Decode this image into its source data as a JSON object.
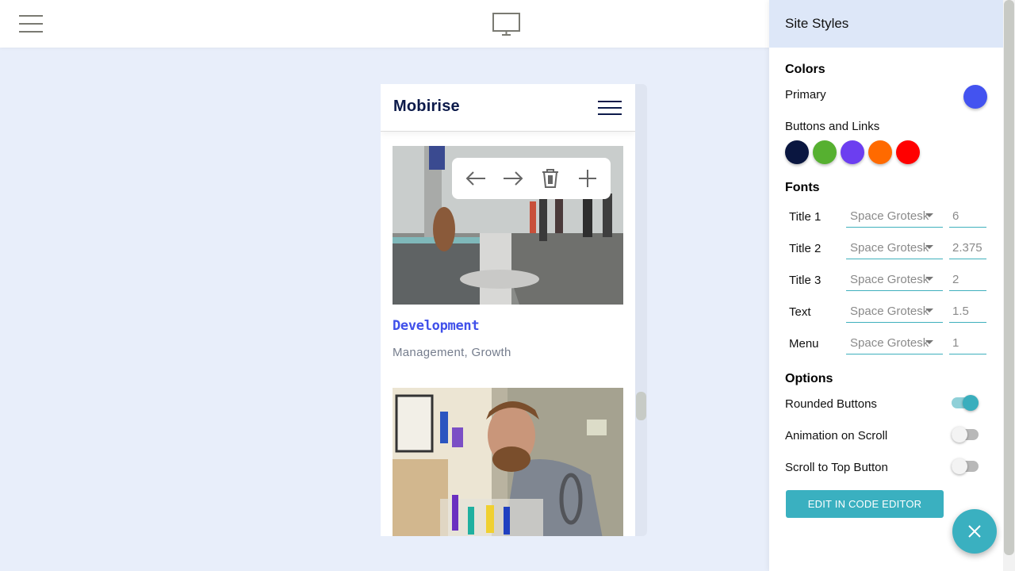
{
  "topbar": {
    "menu_icon": "hamburger-menu-icon",
    "view_icon": "desktop-monitor-icon"
  },
  "preview": {
    "brand": "Mobirise",
    "nav_icon": "hamburger-menu-icon",
    "toolbar": {
      "items": [
        {
          "icon": "arrow-left-icon",
          "action": "move-up"
        },
        {
          "icon": "arrow-right-icon",
          "action": "move-down"
        },
        {
          "icon": "trash-icon",
          "action": "delete"
        },
        {
          "icon": "plus-icon",
          "action": "add"
        }
      ]
    },
    "cards": [
      {
        "title": "Development",
        "subtitle": "Management, Growth",
        "image": "office reception photo"
      },
      {
        "title": "",
        "subtitle": "",
        "image": "man working at desk photo"
      }
    ]
  },
  "panel": {
    "title": "Site Styles",
    "colors": {
      "heading": "Colors",
      "primary_label": "Primary",
      "primary_color": "#4353f0",
      "buttons_label": "Buttons and Links",
      "swatches": [
        "#0a1640",
        "#56b030",
        "#6c3ef0",
        "#ff6a00",
        "#ff0000"
      ]
    },
    "fonts": {
      "heading": "Fonts",
      "rows": [
        {
          "name": "Title 1",
          "font": "Space Grotesk",
          "size": "6"
        },
        {
          "name": "Title 2",
          "font": "Space Grotesk",
          "size": "2.375"
        },
        {
          "name": "Title 3",
          "font": "Space Grotesk",
          "size": "2"
        },
        {
          "name": "Text",
          "font": "Space Grotesk",
          "size": "1.5"
        },
        {
          "name": "Menu",
          "font": "Space Grotesk",
          "size": "1"
        }
      ]
    },
    "options": {
      "heading": "Options",
      "items": [
        {
          "label": "Rounded Buttons",
          "on": true
        },
        {
          "label": "Animation on Scroll",
          "on": false
        },
        {
          "label": "Scroll to Top Button",
          "on": false
        }
      ]
    },
    "code_button": "EDIT IN CODE EDITOR",
    "close_icon": "close-icon"
  }
}
